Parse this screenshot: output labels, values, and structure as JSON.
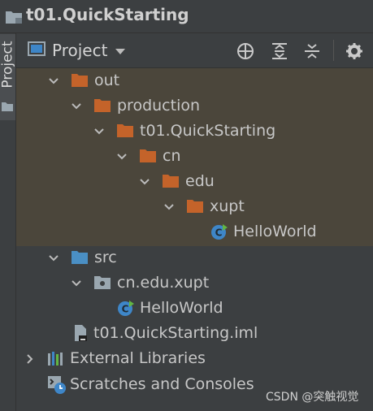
{
  "window": {
    "title": "t01.QuickStarting"
  },
  "side_tab": {
    "label": "Project"
  },
  "toolbar": {
    "view_label": "Project",
    "icons": [
      "locate-icon",
      "expand-all-icon",
      "collapse-all-icon",
      "settings-icon"
    ]
  },
  "colors": {
    "background": "#3c3f41",
    "selected_background": "#4b463b",
    "excluded_folder": "#c4632a",
    "source_folder": "#4a8fc4",
    "package": "#9aa7b0",
    "class_badge": "#3e86c8",
    "text": "#c7c7c7"
  },
  "tree": [
    {
      "label": "out",
      "icon": "excluded-folder-icon",
      "arrow": "down"
    },
    {
      "label": "production",
      "icon": "excluded-folder-icon",
      "arrow": "down"
    },
    {
      "label": "t01.QuickStarting",
      "icon": "excluded-folder-icon",
      "arrow": "down"
    },
    {
      "label": "cn",
      "icon": "excluded-folder-icon",
      "arrow": "down"
    },
    {
      "label": "edu",
      "icon": "excluded-folder-icon",
      "arrow": "down"
    },
    {
      "label": "xupt",
      "icon": "excluded-folder-icon",
      "arrow": "down"
    },
    {
      "label": "HelloWorld",
      "icon": "java-class-icon",
      "arrow": ""
    },
    {
      "label": "src",
      "icon": "source-folder-icon",
      "arrow": "down"
    },
    {
      "label": "cn.edu.xupt",
      "icon": "package-icon",
      "arrow": "down"
    },
    {
      "label": "HelloWorld",
      "icon": "java-class-icon",
      "arrow": ""
    },
    {
      "label": "t01.QuickStarting.iml",
      "icon": "iml-file-icon",
      "arrow": ""
    },
    {
      "label": "External Libraries",
      "icon": "libraries-icon",
      "arrow": "right"
    },
    {
      "label": "Scratches and Consoles",
      "icon": "scratches-icon",
      "arrow": ""
    }
  ],
  "watermark": "CSDN @突触视觉"
}
